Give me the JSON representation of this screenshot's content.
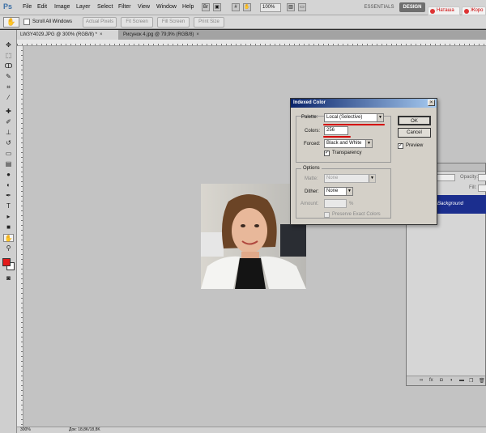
{
  "menubar": {
    "logo": "Ps",
    "items": [
      "File",
      "Edit",
      "Image",
      "Layer",
      "Select",
      "Filter",
      "View",
      "Window",
      "Help"
    ],
    "zoom": "100%",
    "workspaces": {
      "essentials": "ESSENTIALS",
      "design": "DESIGN"
    },
    "browser_tabs": [
      "Наташа",
      "Жоро"
    ]
  },
  "options_bar": {
    "scroll_all_windows": "Scroll All Windows",
    "buttons": [
      "Actual Pixels",
      "Fit Screen",
      "Fill Screen",
      "Print Size"
    ]
  },
  "doc_tabs": [
    {
      "label": "LW3Y4029.JPG @ 300% (RGB/8) *",
      "close": "×"
    },
    {
      "label": "Рисунок 4.jpg @ 79,9% (RGB/8)",
      "close": "×"
    }
  ],
  "toolbox": {
    "tools": [
      "move-icon",
      "marquee-icon",
      "lasso-icon",
      "quick-select-icon",
      "crop-icon",
      "eyedropper-icon",
      "healing-icon",
      "brush-icon",
      "stamp-icon",
      "history-brush-icon",
      "eraser-icon",
      "gradient-icon",
      "blur-icon",
      "dodge-icon",
      "pen-icon",
      "type-icon",
      "path-select-icon",
      "shape-icon",
      "hand-icon",
      "zoom-icon"
    ],
    "foreground_color": "#e41a1a",
    "background_color": "#ffffff"
  },
  "status_bar": {
    "zoom": "300%",
    "doc_size": "Док: 18,8K/18,8K"
  },
  "layers_panel": {
    "opacity_label": "Opacity:",
    "fill_label": "Fill:",
    "layer_name": "Background",
    "footer_icons": [
      "link-icon",
      "fx-icon",
      "mask-icon",
      "adjustment-icon",
      "folder-icon",
      "new-layer-icon",
      "trash-icon"
    ]
  },
  "dialog": {
    "title": "Indexed Color",
    "close": "×",
    "palette_label": "Palette:",
    "palette_value": "Local (Selective)",
    "colors_label": "Colors:",
    "colors_value": "256",
    "forced_label": "Forced:",
    "forced_value": "Black and White",
    "transparency_label": "Transparency",
    "transparency_checked": true,
    "options_legend": "Options",
    "matte_label": "Matte:",
    "matte_value": "None",
    "dither_label": "Dither:",
    "dither_value": "None",
    "amount_label": "Amount:",
    "amount_unit": "%",
    "preserve_label": "Preserve Exact Colors",
    "ok_label": "OK",
    "cancel_label": "Cancel",
    "preview_label": "Preview",
    "preview_checked": true,
    "checkmark": "✓",
    "highlight_color": "#d40000"
  }
}
